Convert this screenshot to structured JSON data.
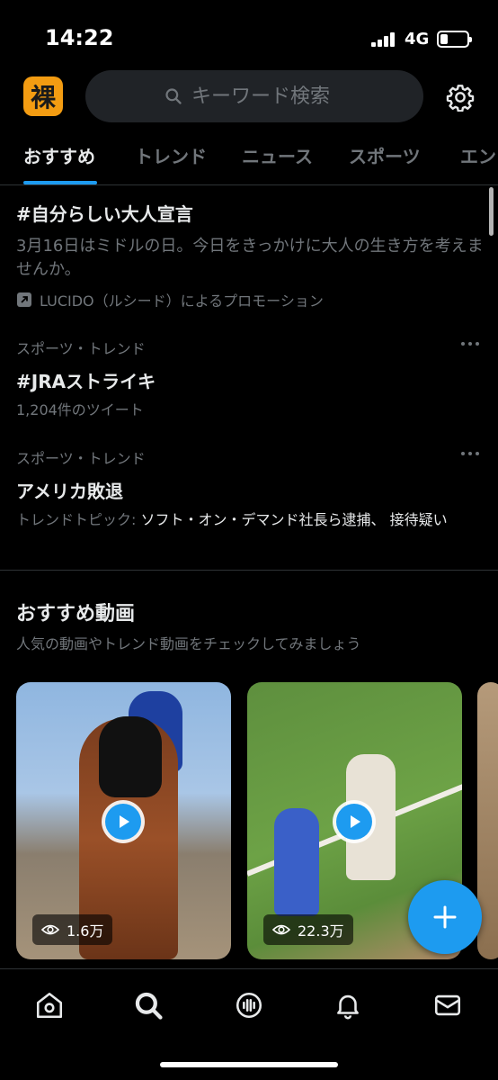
{
  "status_bar": {
    "time": "14:22",
    "network": "4G",
    "battery_level": 0.3
  },
  "header": {
    "logo_text": "裸",
    "search_placeholder": "キーワード検索",
    "icons": {
      "search": "search-icon",
      "settings": "gear-icon"
    }
  },
  "tabs": [
    {
      "label": "おすすめ",
      "active": true
    },
    {
      "label": "トレンド",
      "active": false
    },
    {
      "label": "ニュース",
      "active": false
    },
    {
      "label": "スポーツ",
      "active": false
    },
    {
      "label": "エン",
      "active": false
    }
  ],
  "promo": {
    "title": "#自分らしい大人宣言",
    "description": "3月16日はミドルの日。今日をきっかけに大人の生き方を考えませんか。",
    "sponsor": "LUCIDO（ルシード）によるプロモーション"
  },
  "trends": [
    {
      "category": "スポーツ・トレンド",
      "title": "#JRAストライキ",
      "meta": "1,204件のツイート"
    },
    {
      "category": "スポーツ・トレンド",
      "title": "アメリカ敗退",
      "meta_prefix": "トレンドトピック: ",
      "meta_topic": "ソフト・オン・デマンド社長ら逮捕、 接待疑い"
    }
  ],
  "videos_section": {
    "title": "おすすめ動画",
    "subtitle": "人気の動画やトレンド動画をチェックしてみましょう",
    "videos": [
      {
        "views": "1.6万"
      },
      {
        "views": "22.3万"
      }
    ]
  },
  "fab": {
    "label": "+"
  },
  "bottom_nav": [
    "home-icon",
    "explore-search-icon",
    "spaces-icon",
    "notifications-bell-icon",
    "messages-mail-icon"
  ],
  "colors": {
    "accent": "#1d9bf0",
    "logo": "#f39c12",
    "background": "#000000"
  }
}
